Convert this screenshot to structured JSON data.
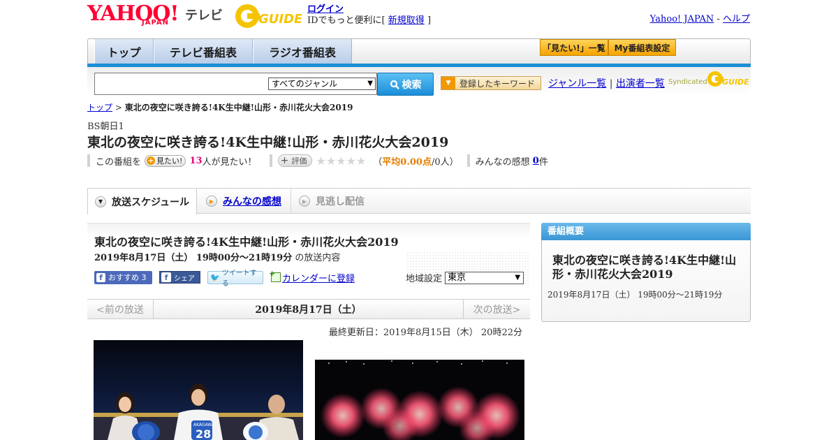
{
  "header": {
    "logo_yahoo": "YAHOO!",
    "logo_japan": "JAPAN",
    "logo_tv": "テレビ",
    "logo_gguide": "GUIDE",
    "login": "ログイン",
    "login_sub_prefix": "IDでもっと便利に[",
    "signup": "新規取得",
    "login_sub_suffix": "]",
    "yahoo_japan_link": "Yahoo! JAPAN",
    "separator": "-",
    "help_link": "ヘルプ"
  },
  "nav": {
    "tabs": [
      "トップ",
      "テレビ番組表",
      "ラジオ番組表"
    ],
    "mitai_list": "「見たい!」一覧",
    "my_bangumi": "My番組表設定"
  },
  "search": {
    "placeholder": "",
    "genre_selected": "すべてのジャンル",
    "search_button": "検索",
    "keyword_button": "登録したキーワード",
    "genre_list": "ジャンル一覧",
    "divider": "|",
    "performer_list": "出演者一覧",
    "syndicated": "Syndicated"
  },
  "breadcrumb": {
    "top": "トップ",
    "sep": ">",
    "current": "東北の夜空に咲き誇る!4K生中継!山形・赤川花火大会2019"
  },
  "program": {
    "channel": "BS朝日1",
    "title": "東北の夜空に咲き誇る!4K生中継!山形・赤川花火大会2019",
    "mitai_prefix": "この番組を",
    "mitai_button": "見たい!",
    "mitai_count": "13",
    "mitai_suffix": "人が見たい！",
    "hyouka_button": "評価",
    "stars": "★★★★★",
    "avg_open": "（",
    "avg_label": "平均0.00点",
    "avg_count": "/0人）",
    "kanso_label": "みんなの感想",
    "kanso_count": "0",
    "kanso_unit": "件"
  },
  "tabs": {
    "schedule": "放送スケジュール",
    "kanso": "みんなの感想",
    "minogashi": "見逃し配信"
  },
  "broadcast": {
    "title": "東北の夜空に咲き誇る!4K生中継!山形・赤川花火大会2019",
    "datetime": "2019年8月17日（土） 19時00分～21時19分",
    "datetime_suffix": " の放送内容",
    "fb_like": "おすすめ 3",
    "fb_share": "シェア",
    "tweet": "ツイートする",
    "calendar": "カレンダーに登録",
    "region_label": "地域設定",
    "region_value": "東京",
    "prev": "<前の放送",
    "current_date": "2019年8月17日（土）",
    "next": "次の放送>",
    "updated": "最終更新日：2019年8月15日（木） 20時22分"
  },
  "sidebar": {
    "heading": "番組概要",
    "title": "東北の夜空に咲き誇る!4K生中継!山形・赤川花火大会2019",
    "time": "2019年8月17日（土） 19時00分～21時19分"
  },
  "photo1": {
    "jersey_name": "AKAGAWA",
    "jersey_number": "28"
  },
  "colors": {
    "brand_red": "#ff0033",
    "accent_blue": "#1a8fd6",
    "link": "#0000cc",
    "mitai_pink": "#e4007f",
    "avg_orange": "#e57c00"
  }
}
